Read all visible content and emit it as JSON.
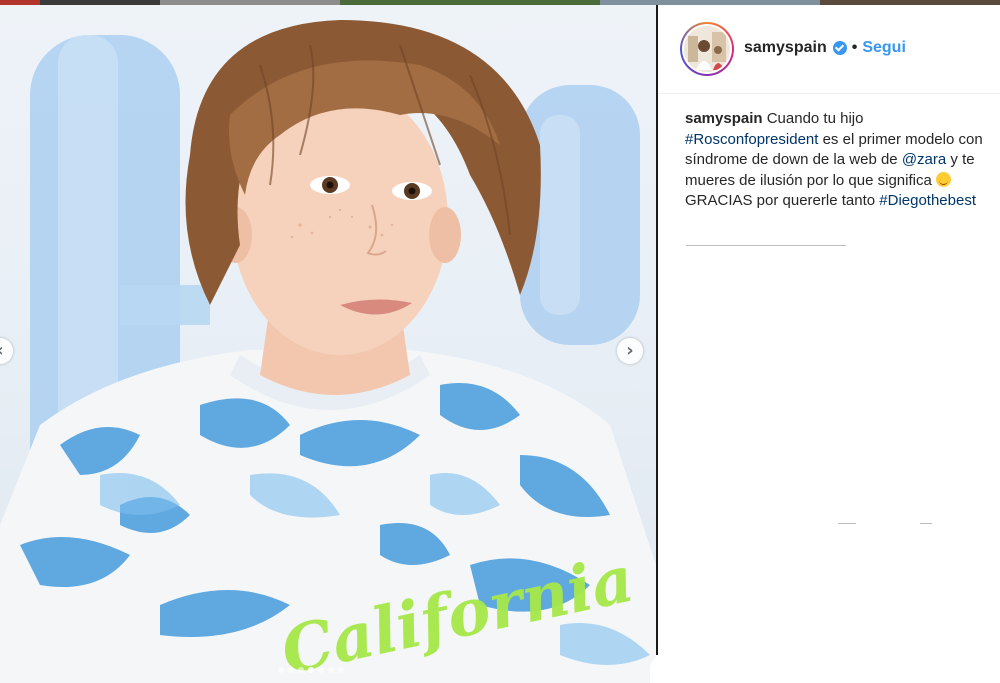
{
  "post": {
    "username": "samyspain",
    "separator": "•",
    "follow_label": "Segui",
    "caption": {
      "username": "samyspain",
      "text_1": " Cuando tu hijo ",
      "hashtag_1": "#Rosconfopresident",
      "text_2": " es el primer modelo con síndrome de down de la web de ",
      "mention": "@zara",
      "text_3": " y te mueres de ilusión por lo que significa ",
      "text_4": "GRACIAS por quererle tanto ",
      "hashtag_2": "#Diegothebest"
    },
    "photo": {
      "shirt_print": "California"
    },
    "carousel": {
      "total": 7,
      "active_index": 3
    }
  },
  "icons": [
    "verified-badge-icon",
    "chevron-left-icon",
    "chevron-right-icon",
    "smiling-emoji-icon"
  ],
  "colors": {
    "link_blue": "#3897f0",
    "hashtag_navy": "#003569",
    "text": "#262626",
    "shirt_dye_blue": "#2f8ed8",
    "print_green": "#a7e84a"
  }
}
